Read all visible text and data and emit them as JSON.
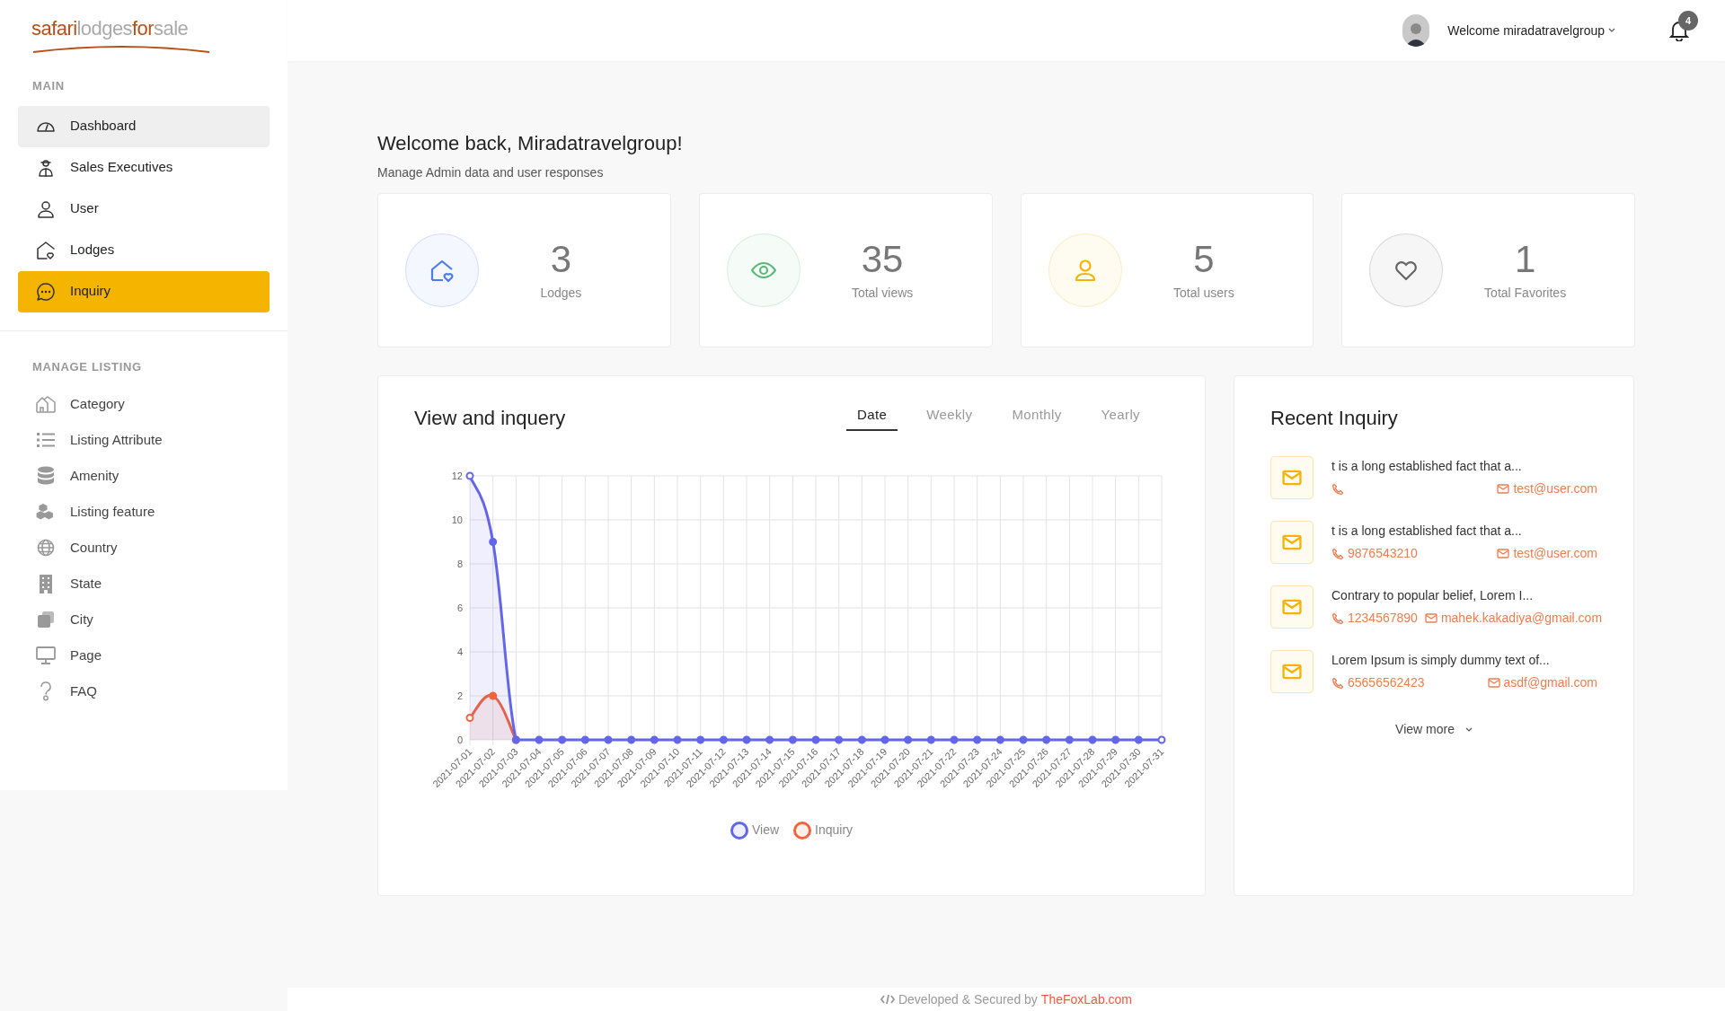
{
  "logo": {
    "part_1": "safari",
    "part_2": "lodges",
    "part_3": "for",
    "part_4": "sale"
  },
  "sidebar": {
    "sections": [
      {
        "title": "MAIN",
        "items": [
          {
            "label": "Dashboard",
            "selected": false,
            "hovered": true
          },
          {
            "label": "Sales Executives",
            "selected": false,
            "hovered": false
          },
          {
            "label": "User",
            "selected": false,
            "hovered": false
          },
          {
            "label": "Lodges",
            "selected": false,
            "hovered": false
          },
          {
            "label": "Inquiry",
            "selected": true,
            "hovered": false
          }
        ]
      },
      {
        "title": "MANAGE LISTING",
        "items": [
          {
            "label": "Category",
            "selected": false,
            "hovered": false
          },
          {
            "label": "Listing Attribute",
            "selected": false,
            "hovered": false
          },
          {
            "label": "Amenity",
            "selected": false,
            "hovered": false
          },
          {
            "label": "Listing feature",
            "selected": false,
            "hovered": false
          },
          {
            "label": "Country",
            "selected": false,
            "hovered": false
          },
          {
            "label": "State",
            "selected": false,
            "hovered": false
          },
          {
            "label": "City",
            "selected": false,
            "hovered": false
          },
          {
            "label": "Page",
            "selected": false,
            "hovered": false
          },
          {
            "label": "FAQ",
            "selected": false,
            "hovered": false
          }
        ]
      }
    ]
  },
  "topbar": {
    "user_menu": "Welcome miradatravelgroup",
    "notification_count": "4"
  },
  "header": {
    "title": "Welcome back, Miradatravelgroup!",
    "subtitle": "Manage Admin data and user responses"
  },
  "stats": [
    {
      "value": "3",
      "label": "Lodges",
      "color": "#4d7cf0"
    },
    {
      "value": "35",
      "label": "Total views",
      "color": "#5cb87a"
    },
    {
      "value": "5",
      "label": "Total users",
      "color": "#f5b400"
    },
    {
      "value": "1",
      "label": "Total Favorites",
      "color": "#666666"
    }
  ],
  "chart_panel": {
    "title": "View and inquery",
    "tabs": [
      {
        "label": "Date",
        "selected": true
      },
      {
        "label": "Weekly",
        "selected": false
      },
      {
        "label": "Monthly",
        "selected": false
      },
      {
        "label": "Yearly",
        "selected": false
      }
    ],
    "chart_data": {
      "type": "area",
      "categories": [
        "2021-07-01",
        "2021-07-02",
        "2021-07-03",
        "2021-07-04",
        "2021-07-05",
        "2021-07-06",
        "2021-07-07",
        "2021-07-08",
        "2021-07-09",
        "2021-07-10",
        "2021-07-11",
        "2021-07-12",
        "2021-07-13",
        "2021-07-14",
        "2021-07-15",
        "2021-07-16",
        "2021-07-17",
        "2021-07-18",
        "2021-07-19",
        "2021-07-20",
        "2021-07-21",
        "2021-07-22",
        "2021-07-23",
        "2021-07-24",
        "2021-07-25",
        "2021-07-26",
        "2021-07-27",
        "2021-07-28",
        "2021-07-29",
        "2021-07-30",
        "2021-07-31"
      ],
      "ylim": [
        0,
        12
      ],
      "grid": true,
      "yticks": [
        0,
        2,
        4,
        6,
        8,
        10,
        12
      ],
      "series": [
        {
          "name": "View",
          "color": "#6366e8",
          "marker": true,
          "values": [
            12,
            9,
            0,
            0,
            0,
            0,
            0,
            0,
            0,
            0,
            0,
            0,
            0,
            0,
            0,
            0,
            0,
            0,
            0,
            0,
            0,
            0,
            0,
            0,
            0,
            0,
            0,
            0,
            0,
            0,
            0
          ]
        },
        {
          "name": "Inquiry",
          "color": "#f2643c",
          "marker": true,
          "values": [
            1,
            2,
            0,
            null,
            null,
            null,
            null,
            null,
            null,
            null,
            null,
            null,
            null,
            null,
            null,
            null,
            null,
            null,
            null,
            null,
            null,
            null,
            null,
            null,
            null,
            null,
            null,
            null,
            null,
            null,
            null
          ]
        }
      ]
    }
  },
  "recent_inquiry": {
    "title": "Recent Inquiry",
    "items": [
      {
        "message": "t is a long established fact that a...",
        "email": "test@user.com"
      },
      {
        "message": "t is a long established fact that a...",
        "phone": "9876543210",
        "email": "test@user.com"
      },
      {
        "message": "Contrary to popular belief, Lorem I...",
        "phone": "1234567890",
        "email": "mahek.kakadiya@gmail.com"
      },
      {
        "message": "Lorem Ipsum is simply dummy text of...",
        "phone": "65656562423",
        "email": "asdf@gmail.com"
      }
    ],
    "view_more": "View more"
  },
  "footer": {
    "text": "Developed & Secured by",
    "link": "TheFoxLab.com"
  }
}
